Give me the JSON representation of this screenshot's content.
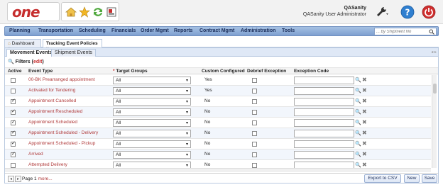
{
  "header": {
    "logo": "one",
    "user_name": "QASanity",
    "user_role": "QASanity User Administrator"
  },
  "nav": {
    "items": [
      "Planning",
      "Transportation",
      "Scheduling",
      "Financials",
      "Order Mgmt",
      "Reports",
      "Contract Mgmt",
      "Administration",
      "Tools"
    ],
    "search_placeholder": "... by Shipment No"
  },
  "page_tabs": [
    {
      "label": "Dashboard"
    },
    {
      "label": "Tracking Event Policies"
    }
  ],
  "sub_tabs": [
    "Movement Events",
    "Shipment Events"
  ],
  "filters": {
    "label": "Filters",
    "edit": "edit"
  },
  "table": {
    "columns": {
      "active": "Active",
      "event_type": "Event Type",
      "target_req": "*",
      "target_groups": "Target Groups",
      "custom_configured": "Custom Configured",
      "debrief_exception": "Debrief Exception",
      "exception_code": "Exception Code"
    },
    "rows": [
      {
        "active": false,
        "event_type": "00-BK Prearranged appointment",
        "target": "All",
        "custom": "Yes",
        "debrief": false
      },
      {
        "active": false,
        "event_type": "Activated for Tendering",
        "target": "All",
        "custom": "Yes",
        "debrief": false
      },
      {
        "active": true,
        "event_type": "Appointment Cancelled",
        "target": "All",
        "custom": "No",
        "debrief": false
      },
      {
        "active": true,
        "event_type": "Appointment Rescheduled",
        "target": "All",
        "custom": "No",
        "debrief": false
      },
      {
        "active": true,
        "event_type": "Appointment Scheduled",
        "target": "All",
        "custom": "No",
        "debrief": false
      },
      {
        "active": true,
        "event_type": "Appointment Scheduled - Delivery",
        "target": "All",
        "custom": "No",
        "debrief": false
      },
      {
        "active": true,
        "event_type": "Appointment Scheduled - Pickup",
        "target": "All",
        "custom": "No",
        "debrief": false
      },
      {
        "active": true,
        "event_type": "Arrived",
        "target": "All",
        "custom": "No",
        "debrief": false
      },
      {
        "active": false,
        "event_type": "Attempted Delivery",
        "target": "All",
        "custom": "No",
        "debrief": false
      }
    ]
  },
  "footer": {
    "page_prefix": "Page",
    "page_number": "1",
    "more": "more...",
    "export_label": "Export to CSV",
    "new_label": "New",
    "save_label": "Save"
  }
}
